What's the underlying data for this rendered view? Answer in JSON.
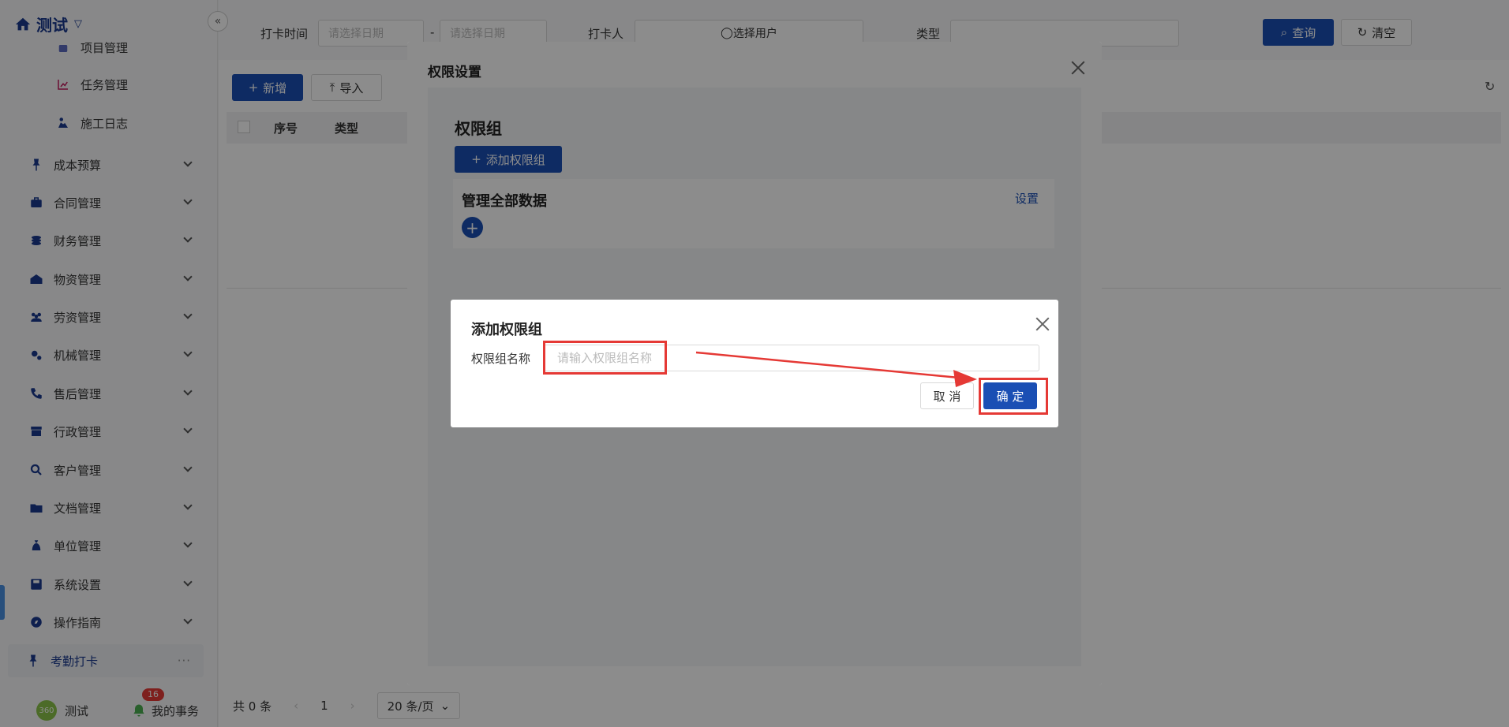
{
  "brand": {
    "title": "测试"
  },
  "sidebar": {
    "sub_items": [
      {
        "label": "项目管理",
        "icon": "list-icon"
      },
      {
        "label": "任务管理",
        "icon": "chart-icon"
      },
      {
        "label": "施工日志",
        "icon": "worker-icon"
      }
    ],
    "items": [
      {
        "label": "成本预算",
        "icon": "pin-icon"
      },
      {
        "label": "合同管理",
        "icon": "briefcase-icon"
      },
      {
        "label": "财务管理",
        "icon": "coins-icon"
      },
      {
        "label": "物资管理",
        "icon": "warehouse-icon"
      },
      {
        "label": "劳资管理",
        "icon": "users-icon"
      },
      {
        "label": "机械管理",
        "icon": "gears-icon"
      },
      {
        "label": "售后管理",
        "icon": "phone-icon"
      },
      {
        "label": "行政管理",
        "icon": "archive-icon"
      },
      {
        "label": "客户管理",
        "icon": "search-user-icon"
      },
      {
        "label": "文档管理",
        "icon": "folder-icon"
      },
      {
        "label": "单位管理",
        "icon": "moneybag-icon"
      },
      {
        "label": "系统设置",
        "icon": "save-icon"
      },
      {
        "label": "操作指南",
        "icon": "compass-icon"
      }
    ],
    "active_item": {
      "label": "考勤打卡",
      "icon": "pin-icon"
    },
    "user": {
      "name": "测试",
      "avatar_text": "360"
    },
    "tasks": {
      "label": "我的事务",
      "badge": "16"
    }
  },
  "filters": {
    "checkin_time_label": "打卡时间",
    "date_start_placeholder": "请选择日期",
    "date_separator": "-",
    "date_end_placeholder": "请选择日期",
    "checkin_person_label": "打卡人",
    "select_user": "选择用户",
    "type_label": "类型",
    "query_button": "查询",
    "clear_button": "清空"
  },
  "toolbar": {
    "add_button": "新增",
    "import_button": "导入"
  },
  "table": {
    "headers": [
      "序号",
      "类型"
    ]
  },
  "pager": {
    "total": "共 0 条",
    "page": "1",
    "page_size": "20 条/页"
  },
  "permission_dialog": {
    "title": "权限设置",
    "section_title": "权限组",
    "add_group_button": "添加权限组",
    "groups": [
      {
        "name": "管理全部数据",
        "settings_link": "设置"
      }
    ]
  },
  "add_group_dialog": {
    "title": "添加权限组",
    "name_label": "权限组名称",
    "name_placeholder": "请输入权限组名称",
    "name_value": "",
    "cancel_button": "取 消",
    "confirm_button": "确 定"
  },
  "colors": {
    "primary": "#1a4fb4",
    "annotation": "#e53935"
  }
}
